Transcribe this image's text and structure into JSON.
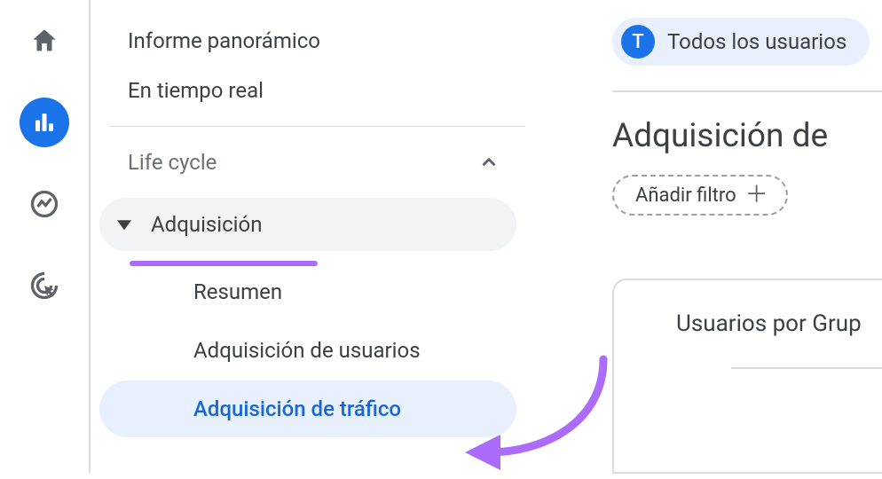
{
  "rail": {
    "items": [
      "home",
      "reports",
      "explore",
      "advertising"
    ]
  },
  "sidebar": {
    "top_links": [
      {
        "label": "Informe panorámico"
      },
      {
        "label": "En tiempo real"
      }
    ],
    "section_label": "Life cycle",
    "group_label": "Adquisición",
    "sub_items": [
      {
        "label": "Resumen"
      },
      {
        "label": "Adquisición de usuarios"
      },
      {
        "label": "Adquisición de tráfico"
      }
    ]
  },
  "main": {
    "audience_badge": "T",
    "audience_label": "Todos los usuarios",
    "page_title": "Adquisición de",
    "add_filter_label": "Añadir filtro",
    "panel_title": "Usuarios por Grup"
  }
}
